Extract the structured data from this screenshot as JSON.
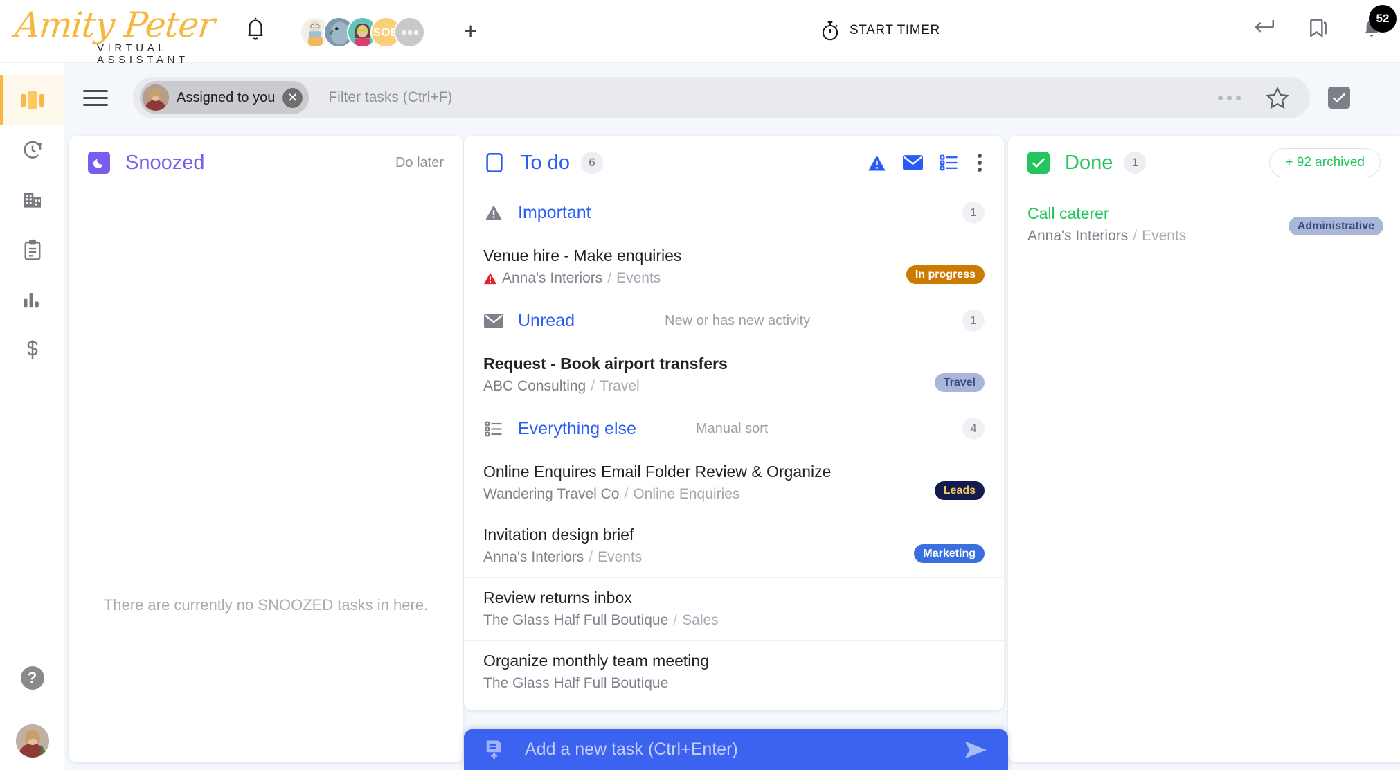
{
  "app": {
    "logo_name": "Amity Peter",
    "logo_tagline": "VIRTUAL ASSISTANT"
  },
  "topbar": {
    "bell_icon": "bell-icon",
    "add_icon": "plus-icon",
    "timer_label": "START TIMER",
    "timer_icon": "stopwatch-icon",
    "back_icon": "return-arrow-icon",
    "bookmark_icon": "bookmark-icon",
    "notification_icon": "notification-bell-icon",
    "notification_count": "52",
    "avatars": [
      {
        "name": "avatar-1",
        "initials": ""
      },
      {
        "name": "avatar-2",
        "initials": ""
      },
      {
        "name": "avatar-3",
        "initials": ""
      },
      {
        "name": "avatar-4",
        "initials": "SOB"
      },
      {
        "name": "avatar-more",
        "initials": ""
      }
    ]
  },
  "rail": {
    "items": [
      {
        "name": "sidebar-item-board",
        "icon": "board-icon",
        "active": true
      },
      {
        "name": "sidebar-item-time",
        "icon": "time-history-icon",
        "active": false
      },
      {
        "name": "sidebar-item-companies",
        "icon": "building-icon",
        "active": false
      },
      {
        "name": "sidebar-item-tasks",
        "icon": "clipboard-icon",
        "active": false
      },
      {
        "name": "sidebar-item-reports",
        "icon": "bar-chart-icon",
        "active": false
      },
      {
        "name": "sidebar-item-billing",
        "icon": "dollar-icon",
        "active": false
      }
    ],
    "help_label": "?",
    "avatar_name": "user-avatar"
  },
  "filterbar": {
    "menu_icon": "hamburger-menu-icon",
    "chip_label": "Assigned to you",
    "chip_close_icon": "close-icon",
    "placeholder": "Filter tasks (Ctrl+F)",
    "more_icon": "more-horizontal-icon",
    "star_icon": "star-icon",
    "checkbox_icon": "checkbox-checked-icon"
  },
  "columns": {
    "snoozed": {
      "icon": "moon-icon",
      "title": "Snoozed",
      "subtitle": "Do later",
      "empty_message": "There are currently no SNOOZED tasks in here.",
      "accent": "#7b5cf0"
    },
    "todo": {
      "icon": "square-outline-icon",
      "title": "To do",
      "count": "6",
      "accent": "#2a5bf7",
      "head_icons": [
        "warning-triangle-icon",
        "envelope-icon",
        "list-icon",
        "more-vertical-icon"
      ],
      "sections": [
        {
          "name": "important",
          "icon": "warning-triangle-icon",
          "title": "Important",
          "note": "",
          "count": "1",
          "tasks": [
            {
              "title": "Venue hire - Make enquiries",
              "company": "Anna's Interiors",
              "context": "Events",
              "tag": "In progress",
              "tag_style": "inprogress",
              "priority_icon": "red-warning-icon",
              "bold": false
            }
          ]
        },
        {
          "name": "unread",
          "icon": "envelope-icon",
          "title": "Unread",
          "note": "New or has new activity",
          "count": "1",
          "tasks": [
            {
              "title": "Request - Book airport transfers",
              "company": "ABC Consulting",
              "context": "Travel",
              "tag": "Travel",
              "tag_style": "travel",
              "priority_icon": "",
              "bold": true
            }
          ]
        },
        {
          "name": "everything-else",
          "icon": "list-icon",
          "title": "Everything else",
          "note": "Manual sort",
          "count": "4",
          "tasks": [
            {
              "title": "Online Enquires Email Folder Review & Organize",
              "company": "Wandering Travel Co",
              "context": "Online Enquiries",
              "tag": "Leads",
              "tag_style": "leads",
              "priority_icon": "",
              "bold": false
            },
            {
              "title": "Invitation design brief",
              "company": "Anna's Interiors",
              "context": "Events",
              "tag": "Marketing",
              "tag_style": "marketing",
              "priority_icon": "",
              "bold": false
            },
            {
              "title": "Review returns inbox",
              "company": "The Glass Half Full Boutique",
              "context": "Sales",
              "tag": "",
              "tag_style": "",
              "priority_icon": "",
              "bold": false
            },
            {
              "title": "Organize monthly team meeting",
              "company": "The Glass Half Full Boutique",
              "context": "",
              "tag": "",
              "tag_style": "",
              "priority_icon": "",
              "bold": false
            }
          ]
        }
      ]
    },
    "done": {
      "icon": "checkbox-checked-icon",
      "title": "Done",
      "count": "1",
      "archived_label": "+ 92 archived",
      "accent": "#22c55e",
      "tasks": [
        {
          "title": "Call caterer",
          "company": "Anna's Interiors",
          "context": "Events",
          "tag": "Administrative",
          "tag_style": "admin"
        }
      ]
    }
  },
  "addbar": {
    "icon": "add-task-icon",
    "placeholder": "Add a new task (Ctrl+Enter)",
    "send_icon": "send-icon"
  }
}
